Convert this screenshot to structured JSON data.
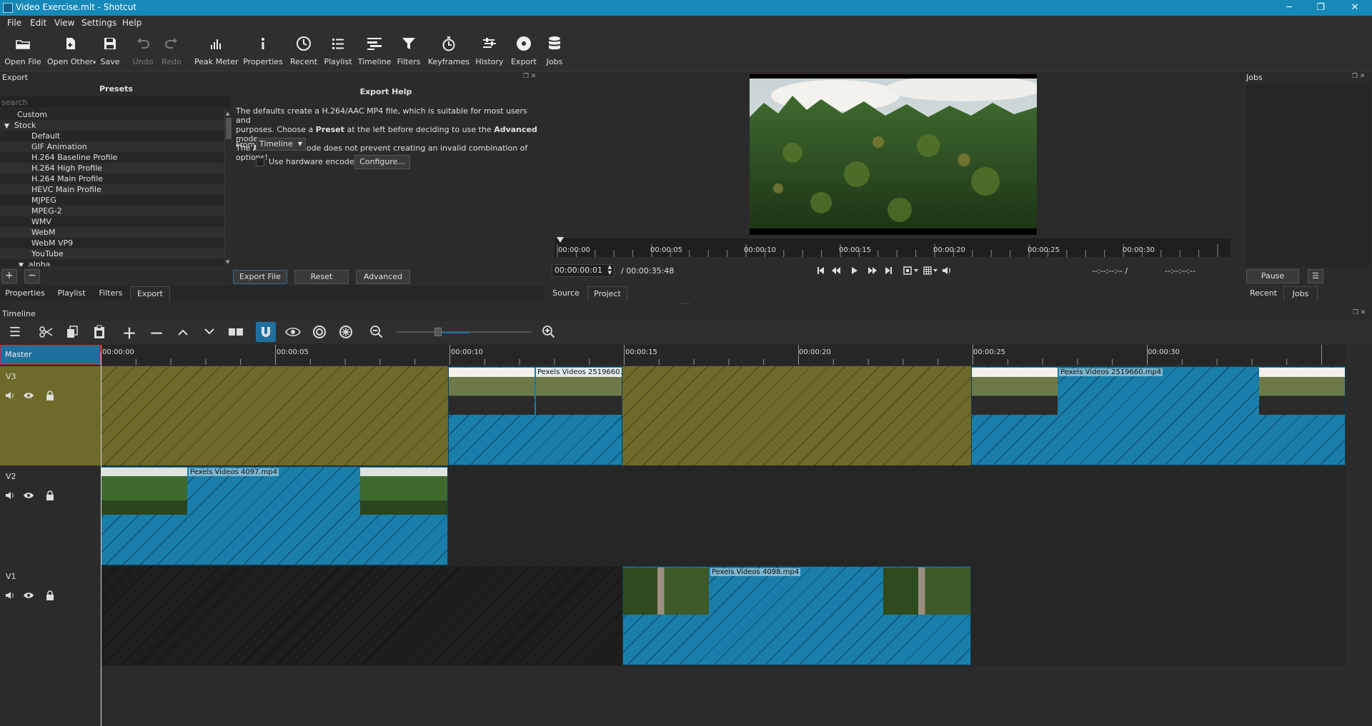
{
  "window": {
    "title": "Video Exercise.mlt - Shotcut",
    "min": "─",
    "max": "❐",
    "close": "✕"
  },
  "menu": [
    "File",
    "Edit",
    "View",
    "Settings",
    "Help"
  ],
  "toolbar": [
    {
      "label": "Open File",
      "icon": "folder-open-icon",
      "enabled": true
    },
    {
      "label": "Open Other",
      "icon": "file-plus-icon",
      "enabled": true
    },
    {
      "label": "Save",
      "icon": "save-icon",
      "enabled": true
    },
    {
      "label": "Undo",
      "icon": "undo-icon",
      "enabled": false
    },
    {
      "label": "Redo",
      "icon": "redo-icon",
      "enabled": false
    },
    {
      "label": "Peak Meter",
      "icon": "peak-meter-icon",
      "enabled": true
    },
    {
      "label": "Properties",
      "icon": "info-icon",
      "enabled": true
    },
    {
      "label": "Recent",
      "icon": "clock-icon",
      "enabled": true
    },
    {
      "label": "Playlist",
      "icon": "list-icon",
      "enabled": true
    },
    {
      "label": "Timeline",
      "icon": "timeline-icon",
      "enabled": true
    },
    {
      "label": "Filters",
      "icon": "funnel-icon",
      "enabled": true
    },
    {
      "label": "Keyframes",
      "icon": "stopwatch-icon",
      "enabled": true
    },
    {
      "label": "History",
      "icon": "history-icon",
      "enabled": true
    },
    {
      "label": "Export",
      "icon": "disc-icon",
      "enabled": true
    },
    {
      "label": "Jobs",
      "icon": "database-icon",
      "enabled": true
    }
  ],
  "export": {
    "panel_title": "Export",
    "presets_title": "Presets",
    "search_placeholder": "search",
    "presets": [
      "Custom",
      "Stock",
      "Default",
      "GIF Animation",
      "H.264 Baseline Profile",
      "H.264 High Profile",
      "H.264 Main Profile",
      "HEVC Main Profile",
      "MJPEG",
      "MPEG-2",
      "WMV",
      "WebM",
      "WebM VP9",
      "YouTube",
      "alpha"
    ],
    "help_title": "Export Help",
    "help_line1": "The defaults create a H.264/AAC MP4 file, which is suitable for most users and",
    "help_line2a": "purposes. Choose a ",
    "help_line2b": "Preset",
    "help_line2c": " at the left before deciding to use the ",
    "help_line2d": "Advanced",
    "help_line2e": " mode.",
    "help_line3a": "The ",
    "help_line3b": "Advanced",
    "help_line3c": " mode does not prevent creating an invalid combination of options!",
    "from_label": "From",
    "from_value": "Timeline",
    "hw_encoder_label": "Use hardware encoder",
    "configure_label": "Configure...",
    "export_file_label": "Export File",
    "reset_label": "Reset",
    "advanced_label": "Advanced",
    "add_label": "+",
    "remove_label": "−"
  },
  "left_tabs": [
    "Properties",
    "Playlist",
    "Filters",
    "Export"
  ],
  "player": {
    "ruler_ticks": [
      "00:00:00",
      "00:00:05",
      "00:00:10",
      "00:00:15",
      "00:00:20",
      "00:00:25",
      "00:00:30"
    ],
    "position": "00:00:00:01",
    "duration": "/ 00:00:35:48",
    "in_point": "--:--:--:-- /",
    "out_point": "--:--:--:--",
    "tabs": [
      "Source",
      "Project"
    ]
  },
  "jobs": {
    "title": "Jobs",
    "pause_label": "Pause",
    "tabs": [
      "Recent",
      "Jobs"
    ]
  },
  "timeline": {
    "title": "Timeline",
    "ruler_ticks": [
      "00:00:00",
      "00:00:05",
      "00:00:10",
      "00:00:15",
      "00:00:20",
      "00:00:25",
      "00:00:30"
    ],
    "master_label": "Master",
    "tracks": [
      {
        "name": "V3",
        "clips": [
          {
            "kind": "blank",
            "start": 0,
            "end": 10
          },
          {
            "kind": "video",
            "start": 10,
            "end": 15,
            "label": "Pexels Videos 2519660.mp4",
            "thumb": "motorbike"
          },
          {
            "kind": "blank",
            "start": 15,
            "end": 25
          },
          {
            "kind": "video",
            "start": 25,
            "end": 35.8,
            "label": "Pexels Videos 2519660.mp4",
            "thumb": "motorbike"
          }
        ]
      },
      {
        "name": "V2",
        "clips": [
          {
            "kind": "video",
            "start": 0,
            "end": 9.95,
            "label": "Pexels Videos 4097.mp4",
            "thumb": "forest"
          }
        ]
      },
      {
        "name": "V1",
        "clips": [
          {
            "kind": "empty",
            "start": 0,
            "end": 15
          },
          {
            "kind": "video",
            "start": 15,
            "end": 25,
            "label": "Pexels Videos 4098.mp4",
            "thumb": "waterfall"
          }
        ]
      }
    ]
  }
}
